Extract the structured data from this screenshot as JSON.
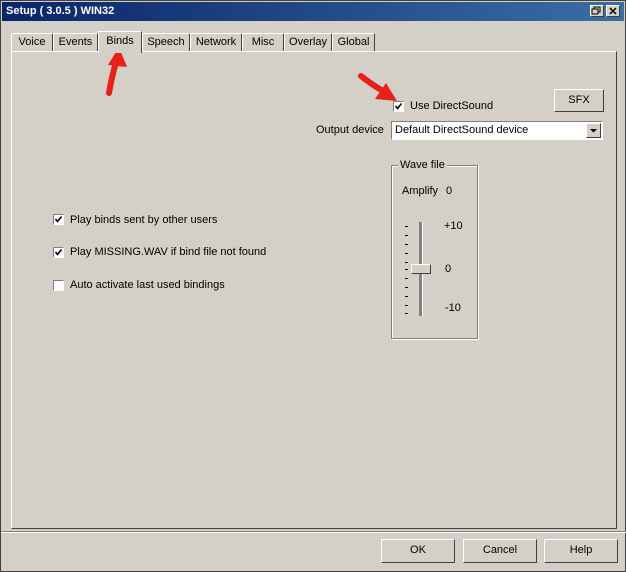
{
  "window": {
    "title": "Setup ( 3.0.5 ) WIN32"
  },
  "tabs": [
    "Voice",
    "Events",
    "Binds",
    "Speech",
    "Network",
    "Misc",
    "Overlay",
    "Global"
  ],
  "active_tab": "Binds",
  "sound": {
    "use_directsound_label": "Use DirectSound",
    "use_directsound_checked": true,
    "sfx_label": "SFX",
    "output_device_label": "Output device",
    "output_device_value": "Default DirectSound device"
  },
  "wave_file": {
    "legend": "Wave file",
    "amplify_label": "Amplify",
    "amplify_value": "0",
    "scale_top": "+10",
    "scale_mid": "0",
    "scale_bottom": "-10"
  },
  "options": [
    {
      "label": "Play binds sent by other users",
      "checked": true
    },
    {
      "label": "Play MISSING.WAV if bind file not found",
      "checked": true
    },
    {
      "label": "Auto activate last used bindings",
      "checked": false
    }
  ],
  "buttons": {
    "ok": "OK",
    "cancel": "Cancel",
    "help": "Help"
  },
  "colors": {
    "annotation_arrow": "#e8201a",
    "titlebar": "#0a246a"
  }
}
